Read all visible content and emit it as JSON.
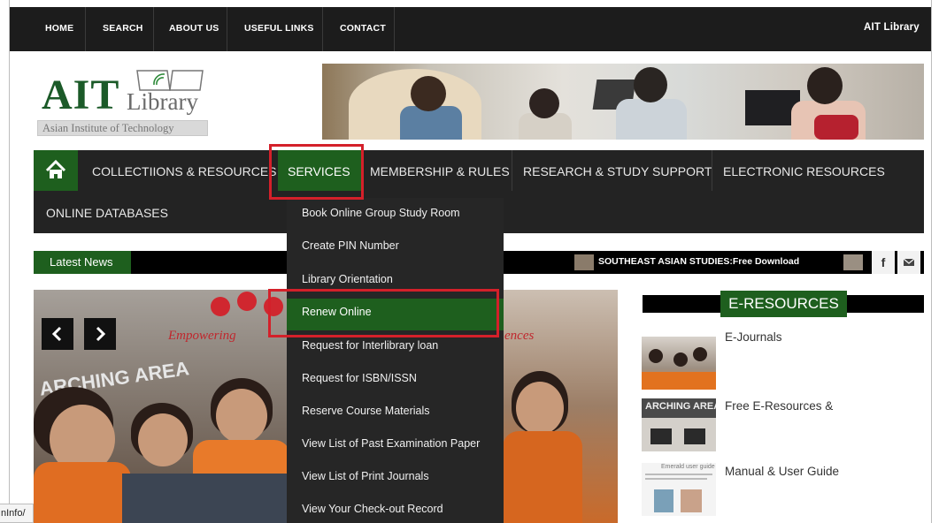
{
  "top_nav": {
    "items": [
      {
        "label": "HOME"
      },
      {
        "label": "SEARCH"
      },
      {
        "label": "ABOUT US"
      },
      {
        "label": "USEFUL LINKS"
      },
      {
        "label": "CONTACT"
      }
    ],
    "right_label": "AIT Library"
  },
  "logo": {
    "ait": "AIT",
    "library": "Library",
    "institute": "Asian Institute of Technology"
  },
  "main_nav": {
    "home_icon": "home-icon",
    "items": [
      {
        "label": "COLLECTIIONS & RESOURCES"
      },
      {
        "label": "SERVICES"
      },
      {
        "label": "MEMBERSHIP & RULES"
      },
      {
        "label": "RESEARCH & STUDY SUPPORT"
      },
      {
        "label": "ELECTRONIC RESOURCES"
      },
      {
        "label": "ONLINE DATABASES"
      }
    ],
    "active_color": "#1e5f1e"
  },
  "services_menu": {
    "items": [
      {
        "label": "Book Online Group Study Room"
      },
      {
        "label": "Create PIN Number"
      },
      {
        "label": "Library Orientation"
      },
      {
        "label": "Renew Online"
      },
      {
        "label": "Request for Interlibrary loan"
      },
      {
        "label": "Request for ISBN/ISSN"
      },
      {
        "label": "Reserve Course Materials"
      },
      {
        "label": "View List of Past Examination Paper"
      },
      {
        "label": "View List of Print Journals"
      },
      {
        "label": "View Your Check-out Record"
      }
    ],
    "highlighted": "Renew Online",
    "highlight_color": "#d4202a"
  },
  "news": {
    "label": "Latest News",
    "ticker": "SOUTHEAST ASIAN STUDIES:Free Download"
  },
  "social": {
    "facebook": "f",
    "email_icon": "envelope-icon"
  },
  "slider": {
    "tagline_left": "Empowering",
    "tagline_right": "ences",
    "prev_icon": "chevron-left-icon",
    "next_icon": "chevron-right-icon",
    "sign_text": "ARCHING AREA"
  },
  "eresources": {
    "title": "E-RESOURCES",
    "items": [
      {
        "label": "E-Journals"
      },
      {
        "label": "Free E-Resources &"
      },
      {
        "label": "Manual & User Guide"
      }
    ],
    "thumb2_text": "ARCHING AREA",
    "thumb3_text": "Emerald user guide"
  },
  "status_url": "nInfo/"
}
